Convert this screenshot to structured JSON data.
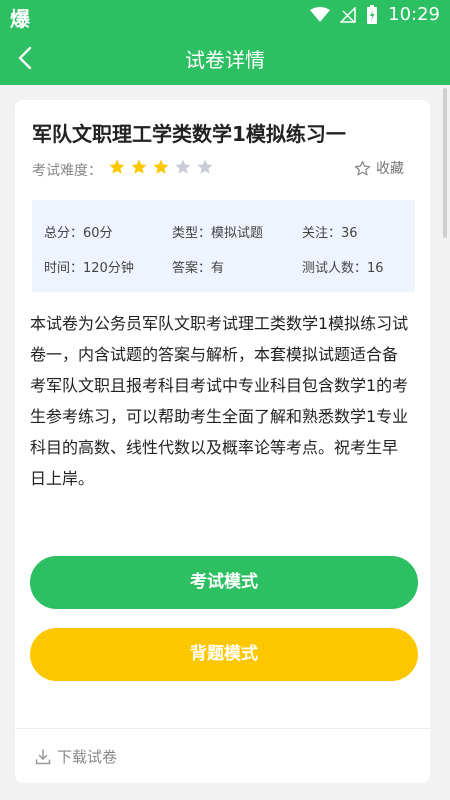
{
  "status_bar": {
    "app_icon_text": "爆",
    "time": "10:29"
  },
  "header": {
    "title": "试卷详情"
  },
  "exam": {
    "title": "军队文职理工学类数学1模拟练习一",
    "difficulty_label": "考试难度：",
    "difficulty_rating": 3,
    "difficulty_max": 5,
    "favorite_label": "收藏",
    "info": {
      "total_score": "总分：60分",
      "type": "类型：模拟试题",
      "followers": "关注：36",
      "duration": "时间：120分钟",
      "answers": "答案：有",
      "test_takers": "测试人数：16"
    },
    "description_lines": [
      "本试卷为公务员军队文职考试理工类数学1模拟练习试",
      "卷一，内含试题的答案与解析，本套模拟试题适合备",
      "考军队文职且报考科目考试中专业科目包含数学1的考",
      "生参考练习，可以帮助考生全面了解和熟悉数学1专业",
      "科目的高数、线性代数以及概率论等考点。祝考生早",
      "日上岸。"
    ]
  },
  "buttons": {
    "exam_mode": "考试模式",
    "review_mode": "背题模式"
  },
  "download_label": "下载试卷",
  "colors": {
    "primary": "#2cc063",
    "accent": "#fdc700",
    "star_active": "#fdc700",
    "star_inactive": "#c9ccd6"
  }
}
